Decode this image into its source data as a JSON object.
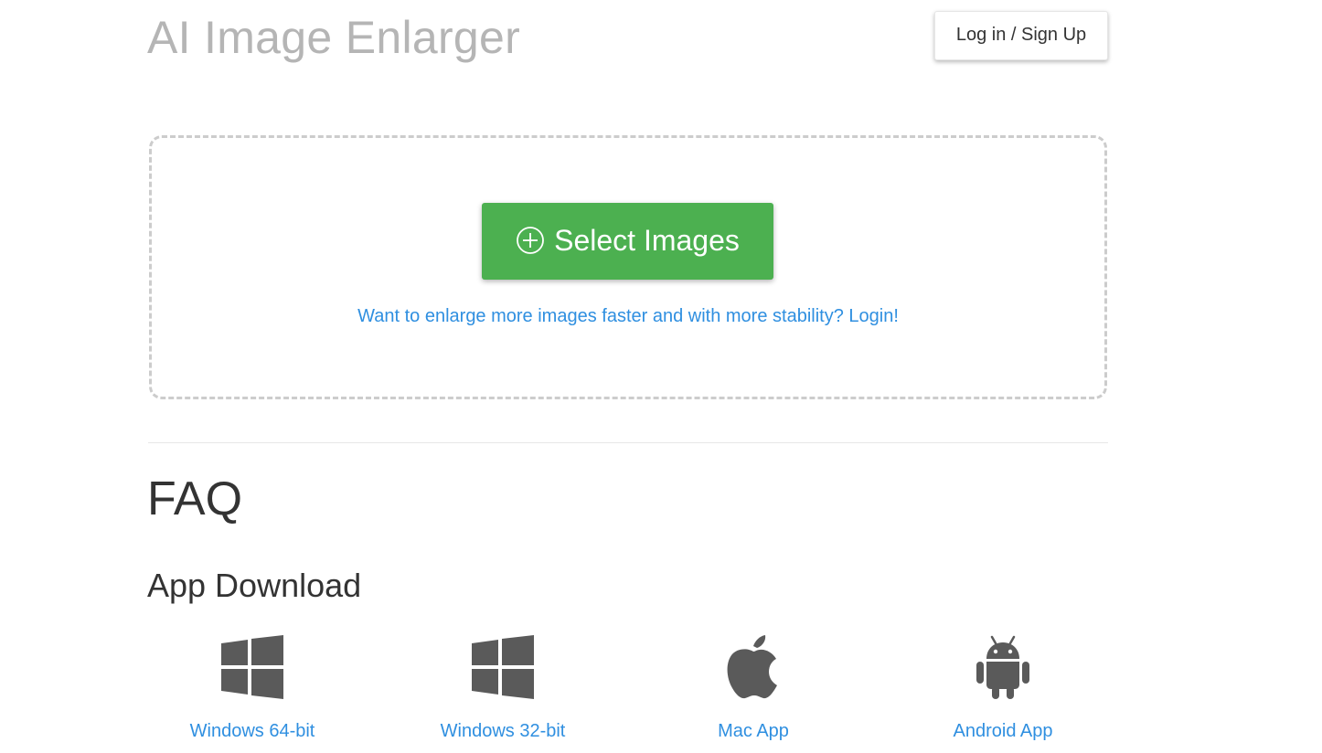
{
  "header": {
    "app_title": "AI Image Enlarger",
    "login_label": "Log in / Sign Up"
  },
  "upload": {
    "select_label": "Select Images",
    "select_icon": "plus-circle-icon",
    "login_hint": "Want to enlarge more images faster and with more stability? Login!",
    "button_color": "#4cb050"
  },
  "faq": {
    "title": "FAQ"
  },
  "downloads": {
    "title": "App Download",
    "items": [
      {
        "label": "Windows 64-bit",
        "icon": "windows-icon"
      },
      {
        "label": "Windows 32-bit",
        "icon": "windows-icon"
      },
      {
        "label": "Mac App",
        "icon": "apple-icon"
      },
      {
        "label": "Android App",
        "icon": "android-icon"
      }
    ]
  },
  "colors": {
    "link": "#2f8fe0",
    "icon": "#5a5a5a",
    "title_muted": "#b5b5b5",
    "text": "#333333"
  }
}
